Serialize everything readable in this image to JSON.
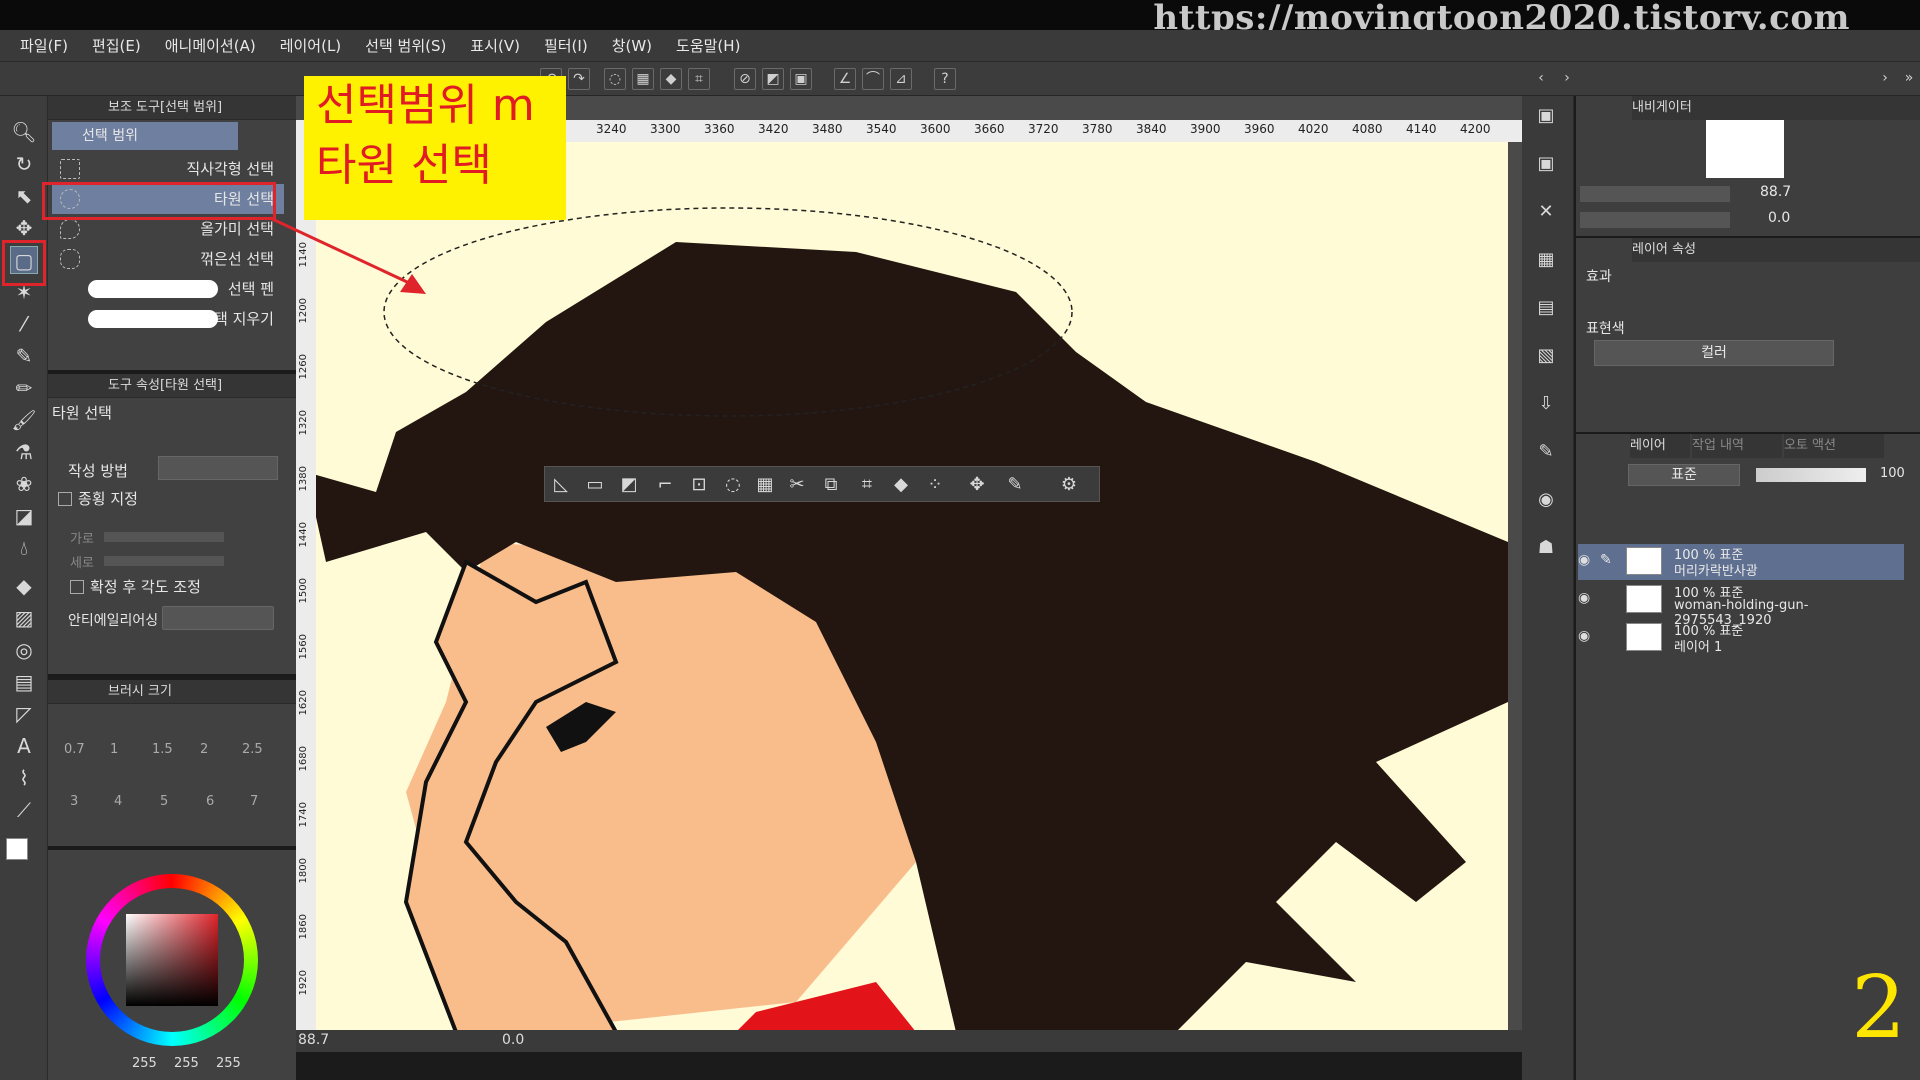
{
  "watermark": "https://movingtoon2020.tistory.com",
  "menu": [
    "파일(F)",
    "편집(E)",
    "애니메이션(A)",
    "레이어(L)",
    "선택 범위(S)",
    "표시(V)",
    "필터(I)",
    "창(W)",
    "도움말(H)"
  ],
  "subtool_panel": {
    "title": "보조 도구[선택 범위]",
    "group": "선택 범위",
    "items": [
      "직사각형 선택",
      "타원 선택",
      "올가미 선택",
      "꺾은선 선택",
      "선택 펜",
      "선택 지우기"
    ]
  },
  "tool_property": {
    "title": "도구 속성[타원 선택]",
    "tool_name": "타원 선택",
    "create_method_label": "작성 방법",
    "aspect_label": "종횡 지정",
    "width_label": "가로",
    "height_label": "세로",
    "adjust_angle_label": "확정 후 각도 조정",
    "antialias_label": "안티에일리어싱"
  },
  "brush_size": {
    "title": "브러시 크기",
    "values": [
      "0.7",
      "1",
      "1.5",
      "2",
      "2.5",
      "3",
      "4",
      "5",
      "6",
      "7"
    ]
  },
  "color": {
    "r": "255",
    "g": "255",
    "b": "255",
    "accent": "#e0242b"
  },
  "callout": {
    "line1": "선택범위 m",
    "line2": "타원 선택"
  },
  "ruler_ticks": [
    "3240",
    "3300",
    "3360",
    "3420",
    "3480",
    "3540",
    "3600",
    "3660",
    "3720",
    "3780",
    "3840",
    "3900",
    "3960",
    "4020",
    "4080",
    "4140",
    "4200"
  ],
  "vruler_ticks": [
    "1140",
    "1200",
    "1260",
    "1320",
    "1380",
    "1440",
    "1500",
    "1560",
    "1620",
    "1680",
    "1740",
    "1800",
    "1860",
    "1920"
  ],
  "status": {
    "zoom": "88.7",
    "rotation": "0.0"
  },
  "navigator": {
    "title": "내비게이터",
    "zoom": "88.7",
    "rotation": "0.0"
  },
  "layer_property": {
    "title": "레이어 속성",
    "effect_label": "효과",
    "expression_label": "표현색",
    "expression_value": "컬러"
  },
  "layer_panel": {
    "tabs": [
      "레이어",
      "작업 내역",
      "오토 액션"
    ],
    "blend_mode": "표준",
    "opacity": "100",
    "layers": [
      {
        "line1": "100 % 표준",
        "line2": "머리카락반사광"
      },
      {
        "line1": "100 % 표준",
        "line2": "woman-holding-gun-2975543_1920"
      },
      {
        "line1": "100 % 표준",
        "line2": "레이어 1"
      }
    ]
  },
  "page_number": "2"
}
